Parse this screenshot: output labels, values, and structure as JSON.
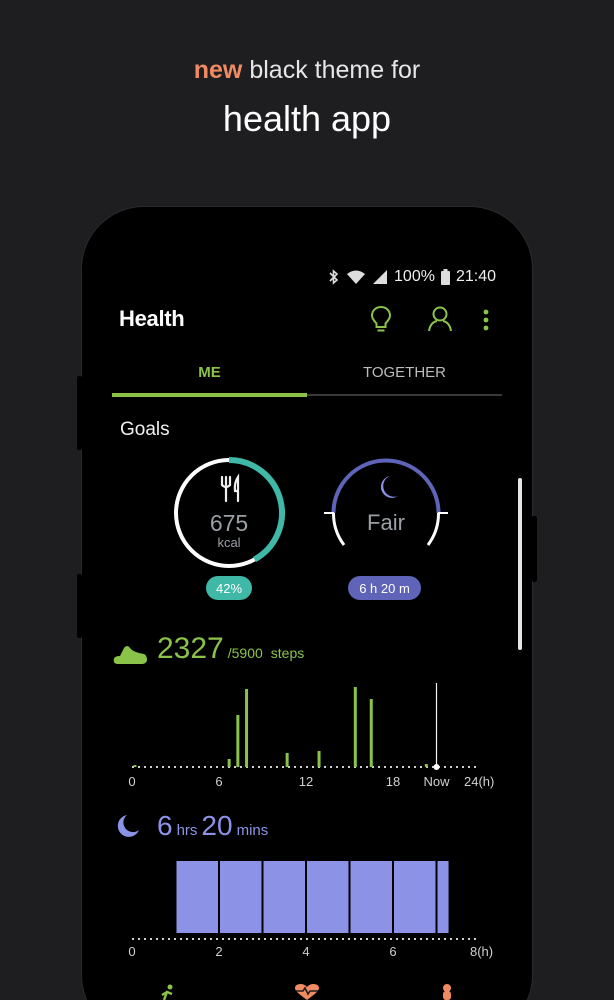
{
  "promo": {
    "accent": "new",
    "line1": "black theme for",
    "line2": "health app"
  },
  "status_bar": {
    "battery": "100%",
    "time": "21:40"
  },
  "app": {
    "title": "Health",
    "tabs": [
      {
        "label": "ME",
        "active": true
      },
      {
        "label": "TOGETHER",
        "active": false
      }
    ]
  },
  "goals": {
    "title": "Goals",
    "food": {
      "value": "675",
      "unit": "kcal",
      "badge": "42%",
      "progress": 0.42
    },
    "sleep": {
      "label": "Fair",
      "badge": "6 h 20 m"
    }
  },
  "steps": {
    "count": "2327",
    "goal": "/5900",
    "unit": "steps"
  },
  "sleep_summary": {
    "hours": "6",
    "hours_unit": "hrs",
    "mins": "20",
    "mins_unit": "mins"
  },
  "chart_data": [
    {
      "type": "bar",
      "title": "",
      "xlabel": "",
      "ylabel": "",
      "x_ticks": [
        "0",
        "6",
        "12",
        "18",
        "Now",
        "24(h)"
      ],
      "xlim": [
        0,
        24
      ],
      "x": [
        0.2,
        6.7,
        7.3,
        7.9,
        10.7,
        12.9,
        15.4,
        16.5,
        20.3
      ],
      "values": [
        2,
        8,
        52,
        78,
        14,
        16,
        80,
        68,
        3
      ],
      "now": 21.0,
      "color": "#8bc34a"
    },
    {
      "type": "bar",
      "title": "",
      "xlabel": "",
      "ylabel": "",
      "x_ticks": [
        "0",
        "2",
        "4",
        "6",
        "8(h)"
      ],
      "xlim": [
        0,
        8
      ],
      "segments": [
        [
          1.0,
          2.0
        ],
        [
          2.0,
          3.0
        ],
        [
          3.0,
          4.0
        ],
        [
          4.0,
          5.0
        ],
        [
          5.0,
          6.0
        ],
        [
          6.0,
          7.0
        ],
        [
          7.0,
          7.3
        ]
      ],
      "color": "#8c93e6"
    }
  ],
  "colors": {
    "green": "#8bc34a",
    "teal": "#3fb8a7",
    "purple": "#5f64b8",
    "accent": "#f08a63"
  }
}
